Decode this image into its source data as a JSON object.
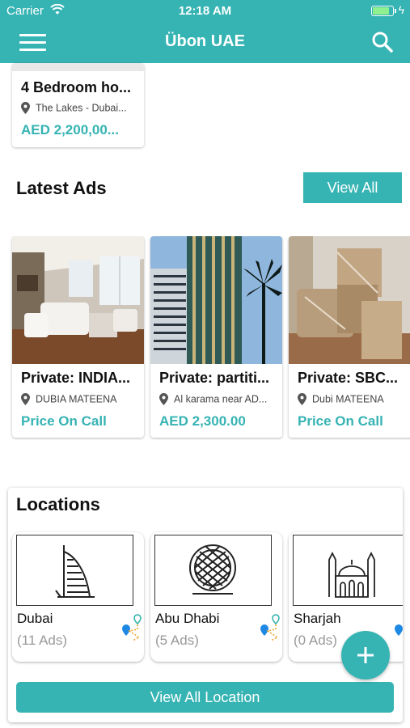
{
  "status_bar": {
    "carrier": "Carrier",
    "time": "12:18 AM"
  },
  "header": {
    "title": "Übon UAE",
    "menu_icon": "hamburger-menu-icon",
    "search_icon": "search-icon"
  },
  "featured_card": {
    "title": "4 Bedroom ho...",
    "location": "The Lakes - Dubai...",
    "price": "AED 2,200,00..."
  },
  "latest_ads": {
    "heading": "Latest Ads",
    "view_all_label": "View All",
    "items": [
      {
        "title": "Private: INDIA...",
        "location": "DUBIA MATEENA",
        "price": "Price On Call"
      },
      {
        "title": "Private: partiti...",
        "location": "Al karama near AD...",
        "price": "AED 2,300.00"
      },
      {
        "title": "Private: SBC...",
        "location": "Dubi MATEENA",
        "price": "Price On Call"
      }
    ]
  },
  "locations": {
    "heading": "Locations",
    "items": [
      {
        "name": "Dubai",
        "count": "(11 Ads)"
      },
      {
        "name": "Abu Dhabi",
        "count": "(5 Ads)"
      },
      {
        "name": "Sharjah",
        "count": "(0 Ads)"
      }
    ],
    "view_all_label": "View All Location"
  },
  "fab": {
    "icon": "plus-icon"
  },
  "colors": {
    "accent": "#36b3b3",
    "text": "#111111",
    "muted": "#999999"
  }
}
